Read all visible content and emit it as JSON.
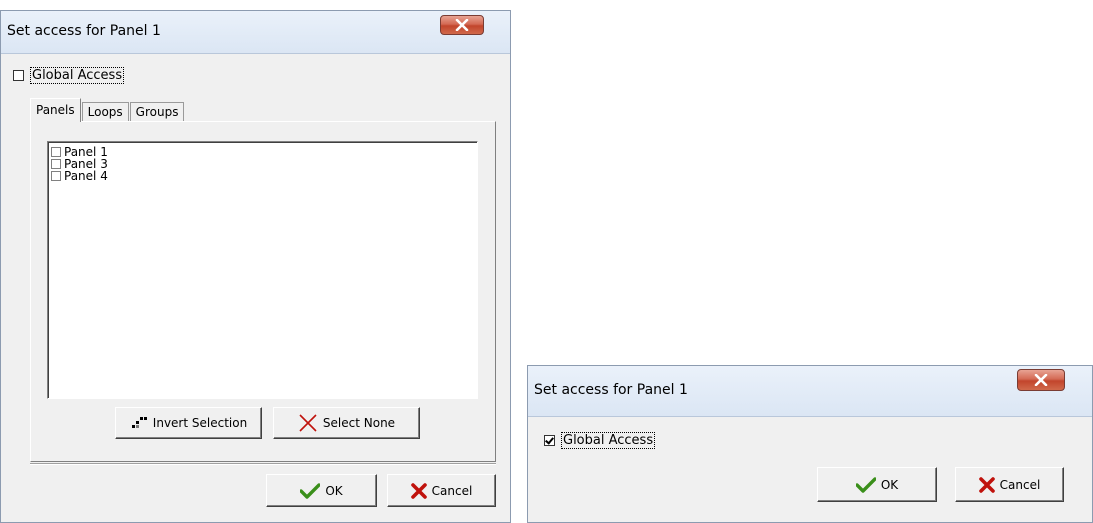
{
  "dialog_large": {
    "title": "Set access for Panel 1",
    "global_access": {
      "label": "Global Access",
      "checked": false
    },
    "tabs": [
      {
        "label": "Panels",
        "active": true
      },
      {
        "label": "Loops",
        "active": false
      },
      {
        "label": "Groups",
        "active": false
      }
    ],
    "panels_list": [
      {
        "label": "Panel 1",
        "checked": false
      },
      {
        "label": "Panel 3",
        "checked": false
      },
      {
        "label": "Panel 4",
        "checked": false
      }
    ],
    "invert_selection_label": "Invert Selection",
    "select_none_label": "Select None",
    "ok_label": "OK",
    "cancel_label": "Cancel"
  },
  "dialog_small": {
    "title": "Set access for Panel 1",
    "global_access": {
      "label": "Global Access",
      "checked": true
    },
    "ok_label": "OK",
    "cancel_label": "Cancel"
  },
  "colors": {
    "ok_check": "#3a8f1a",
    "cancel_x": "#c0120c",
    "close_button": "#c7452c"
  },
  "icons": {
    "close": "close-x-icon",
    "ok": "checkmark-icon",
    "cancel": "red-x-icon",
    "invert": "invert-selection-icon",
    "select_none": "thin-x-icon"
  }
}
